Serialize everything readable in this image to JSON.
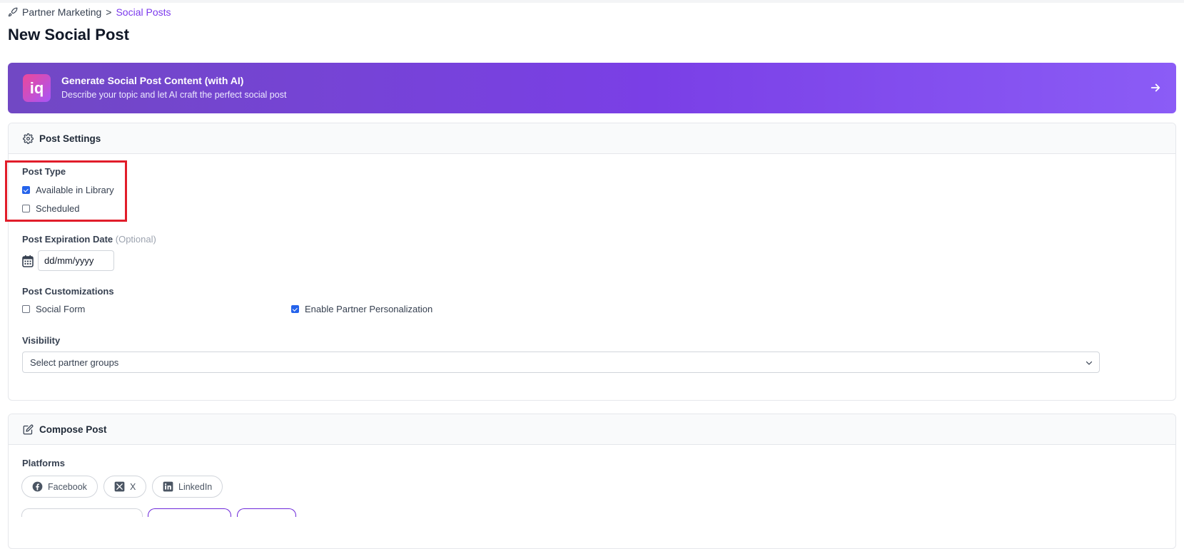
{
  "breadcrumb": {
    "parent": "Partner Marketing",
    "separator": ">",
    "current": "Social Posts"
  },
  "page": {
    "title": "New Social Post"
  },
  "ai_banner": {
    "logo_text": "iq",
    "title": "Generate Social Post Content (with AI)",
    "subtitle": "Describe your topic and let AI craft the perfect social post"
  },
  "post_settings": {
    "title": "Post Settings",
    "post_type": {
      "label": "Post Type",
      "options": [
        {
          "label": "Available in Library",
          "checked": true
        },
        {
          "label": "Scheduled",
          "checked": false
        }
      ]
    },
    "expiration": {
      "label": "Post Expiration Date",
      "optional": "(Optional)",
      "placeholder": "dd/mm/yyyy"
    },
    "customizations": {
      "label": "Post Customizations",
      "options": [
        {
          "label": "Social Form",
          "checked": false
        },
        {
          "label": "Enable Partner Personalization",
          "checked": true
        }
      ]
    },
    "visibility": {
      "label": "Visibility",
      "placeholder": "Select partner groups"
    }
  },
  "compose": {
    "title": "Compose Post",
    "platforms_label": "Platforms",
    "platforms": [
      {
        "label": "Facebook",
        "icon": "facebook-icon"
      },
      {
        "label": "X",
        "icon": "x-icon"
      },
      {
        "label": "LinkedIn",
        "icon": "linkedin-icon"
      }
    ]
  },
  "colors": {
    "accent": "#7c3aed",
    "checkbox": "#2563eb",
    "highlight": "#e11d2a"
  }
}
